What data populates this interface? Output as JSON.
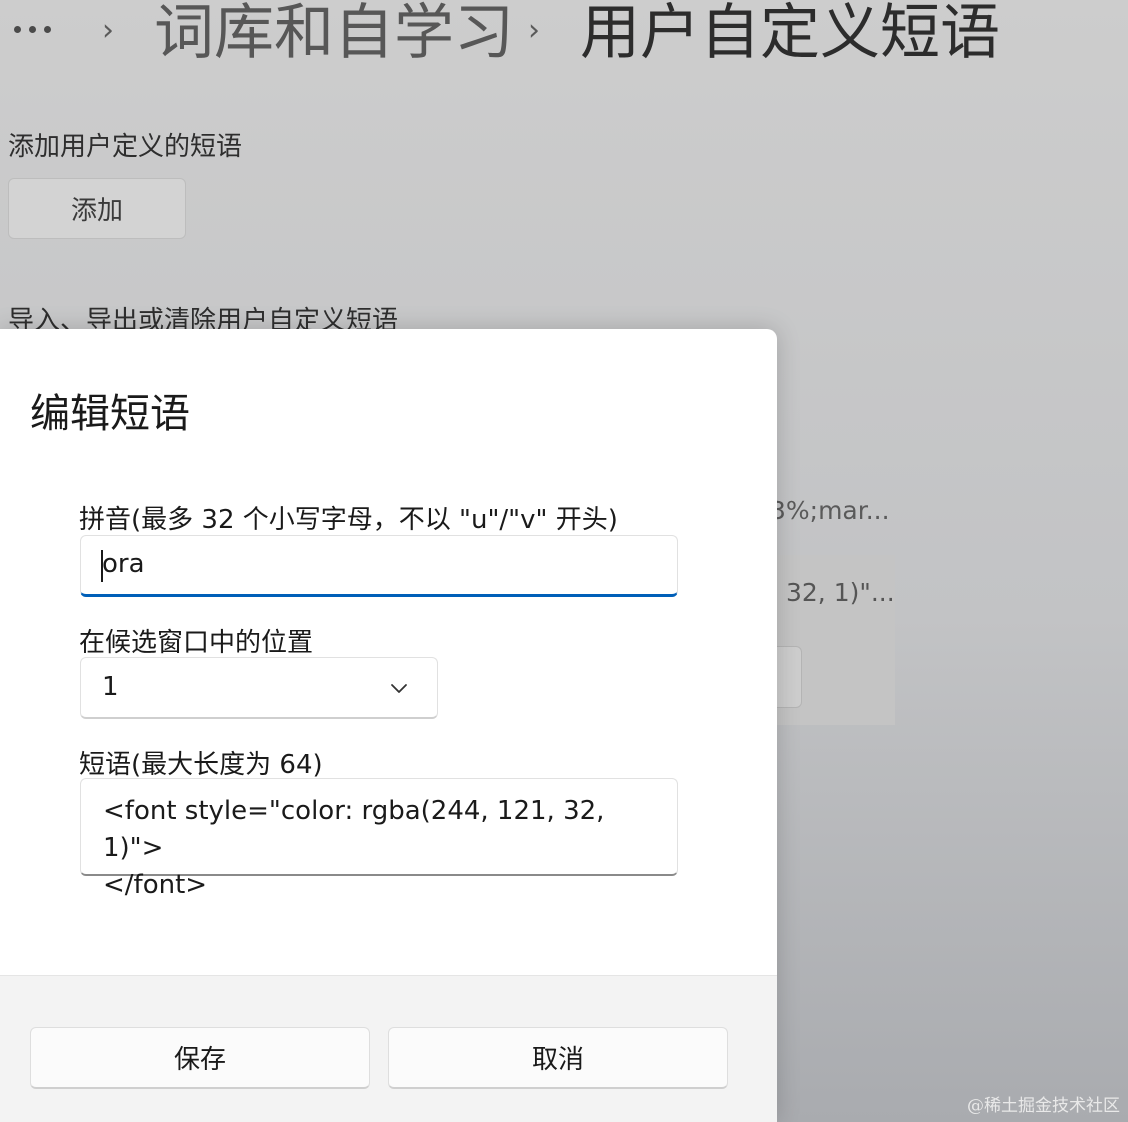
{
  "breadcrumb": {
    "parent": "词库和自学习",
    "current": "用户自定义短语"
  },
  "background": {
    "add_phrase_label": "添加用户定义的短语",
    "add_button": "添加",
    "import_export_label": "导入、导出或清除用户自定义短语",
    "fragment_1": "3%;mar...",
    "fragment_2": "32, 1)\"..."
  },
  "dialog": {
    "title": "编辑短语",
    "pinyin_label": "拼音(最多 32 个小写字母，不以 \"u\"/\"v\" 开头)",
    "pinyin_value": "ora",
    "position_label": "在候选窗口中的位置",
    "position_value": "1",
    "phrase_label": "短语(最大长度为 64)",
    "phrase_value": "<font style=\"color: rgba(244, 121, 32, 1)\">\n</font>",
    "save_button": "保存",
    "cancel_button": "取消"
  },
  "watermark": "@稀土掘金技术社区",
  "icons": {
    "more": "more-dots-icon",
    "separator": "chevron-right-icon",
    "dropdown": "chevron-down-icon"
  },
  "colors": {
    "accent": "#005fb8"
  }
}
